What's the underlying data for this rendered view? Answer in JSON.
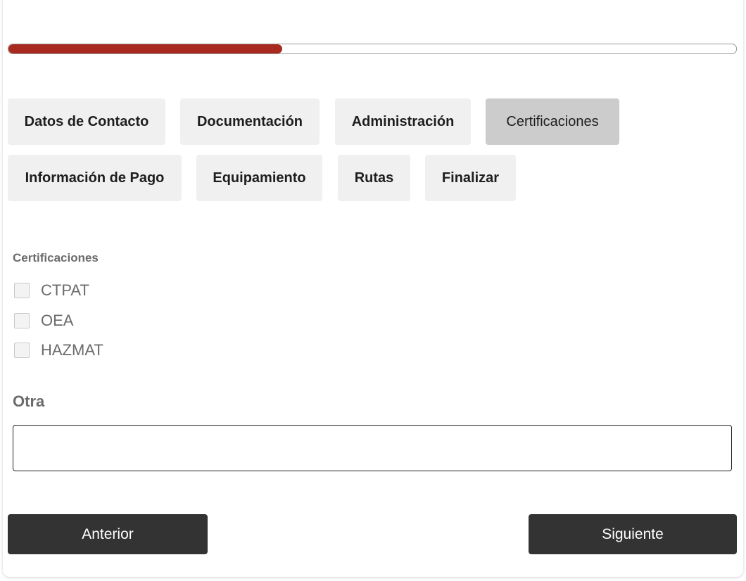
{
  "progress": {
    "percent": 37.6,
    "fill_color": "#a8291f"
  },
  "tabs": [
    {
      "label": "Datos de Contacto",
      "active": false
    },
    {
      "label": "Documentación",
      "active": false
    },
    {
      "label": "Administración",
      "active": false
    },
    {
      "label": "Certificaciones",
      "active": true
    },
    {
      "label": "Información de Pago",
      "active": false
    },
    {
      "label": "Equipamiento",
      "active": false
    },
    {
      "label": "Rutas",
      "active": false
    },
    {
      "label": "Finalizar",
      "active": false
    }
  ],
  "certifications": {
    "section_label": "Certificaciones",
    "options": [
      {
        "label": "CTPAT",
        "checked": false
      },
      {
        "label": "OEA",
        "checked": false
      },
      {
        "label": "HAZMAT",
        "checked": false
      }
    ]
  },
  "other": {
    "label": "Otra",
    "value": "",
    "placeholder": ""
  },
  "nav": {
    "prev_label": "Anterior",
    "next_label": "Siguiente"
  }
}
